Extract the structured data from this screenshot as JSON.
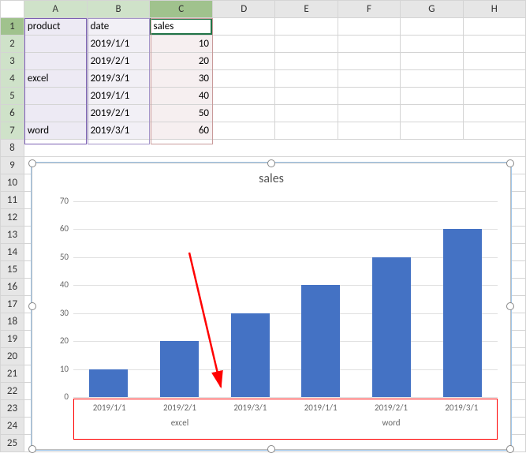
{
  "sheet": {
    "columns": [
      "A",
      "B",
      "C",
      "D",
      "E",
      "F",
      "G",
      "H"
    ],
    "rows": [
      "1",
      "2",
      "3",
      "4",
      "5",
      "6",
      "7",
      "8",
      "9",
      "10",
      "11",
      "12",
      "13",
      "14",
      "15",
      "16",
      "17",
      "18",
      "19",
      "20",
      "21",
      "22",
      "23",
      "24",
      "25"
    ],
    "headers": {
      "A1": "product",
      "B1": "date",
      "C1": "sales"
    },
    "data": {
      "A4": "excel",
      "A7": "word",
      "B2": "2019/1/1",
      "B3": "2019/2/1",
      "B4": "2019/3/1",
      "B5": "2019/1/1",
      "B6": "2019/2/1",
      "B7": "2019/3/1",
      "C2": "10",
      "C3": "20",
      "C4": "30",
      "C5": "40",
      "C6": "50",
      "C7": "60"
    }
  },
  "chart_data": {
    "type": "bar",
    "title": "sales",
    "categories": [
      "2019/1/1",
      "2019/2/1",
      "2019/3/1",
      "2019/1/1",
      "2019/2/1",
      "2019/3/1"
    ],
    "groups": [
      {
        "name": "excel",
        "span": 3
      },
      {
        "name": "word",
        "span": 3
      }
    ],
    "values": [
      10,
      20,
      30,
      40,
      50,
      60
    ],
    "ylim": [
      0,
      70
    ],
    "yticks": [
      0,
      10,
      20,
      30,
      40,
      50,
      60,
      70
    ],
    "xlabel": "",
    "ylabel": ""
  }
}
